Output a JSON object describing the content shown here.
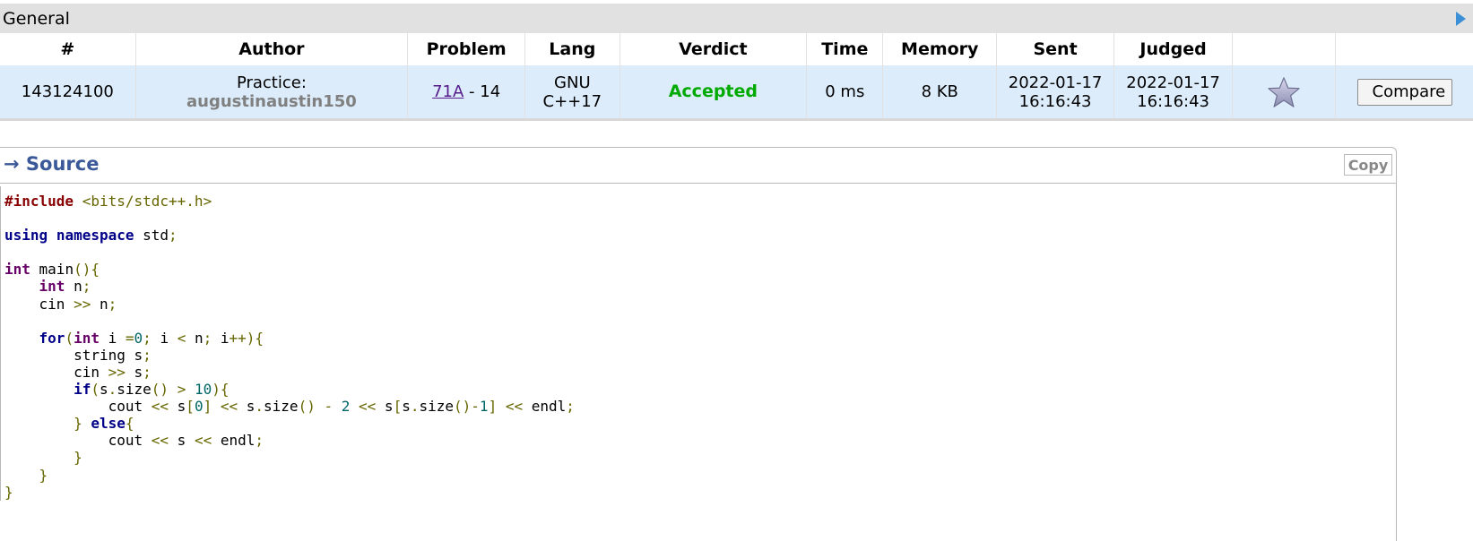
{
  "general": {
    "title": "General",
    "columns": [
      "#",
      "Author",
      "Problem",
      "Lang",
      "Verdict",
      "Time",
      "Memory",
      "Sent",
      "Judged",
      "",
      ""
    ],
    "row": {
      "id": "143124100",
      "author_prefix": "Practice:",
      "author_handle": "augustinaustin150",
      "problem_link": "71A",
      "problem_suffix": " - 14",
      "lang_line1": "GNU",
      "lang_line2": "C++17",
      "verdict": "Accepted",
      "time": "0 ms",
      "memory": "8 KB",
      "sent_date": "2022-01-17",
      "sent_time": "16:16:43",
      "judged_date": "2022-01-17",
      "judged_time": "16:16:43",
      "compare_label": "Compare"
    },
    "colors": {
      "header_bg": "#e1e1e1",
      "row_bg": "#dcecfb",
      "accepted": "#00aa00",
      "link": "#551a8b"
    }
  },
  "source": {
    "title": "→ Source",
    "copy_label": "Copy",
    "code_lines": [
      [
        [
          "pp",
          "#include"
        ],
        [
          "pl",
          " "
        ],
        [
          "op",
          "<bits/stdc++.h>"
        ]
      ],
      [],
      [
        [
          "kw",
          "using"
        ],
        [
          "pl",
          " "
        ],
        [
          "kw",
          "namespace"
        ],
        [
          "pl",
          " std"
        ],
        [
          "op",
          ";"
        ]
      ],
      [],
      [
        [
          "ty",
          "int"
        ],
        [
          "pl",
          " main"
        ],
        [
          "op",
          "(){"
        ]
      ],
      [
        [
          "pl",
          "    "
        ],
        [
          "ty",
          "int"
        ],
        [
          "pl",
          " n"
        ],
        [
          "op",
          ";"
        ]
      ],
      [
        [
          "pl",
          "    cin "
        ],
        [
          "op",
          ">>"
        ],
        [
          "pl",
          " n"
        ],
        [
          "op",
          ";"
        ]
      ],
      [],
      [
        [
          "pl",
          "    "
        ],
        [
          "kw",
          "for"
        ],
        [
          "op",
          "("
        ],
        [
          "ty",
          "int"
        ],
        [
          "pl",
          " i "
        ],
        [
          "op",
          "="
        ],
        [
          "num",
          "0"
        ],
        [
          "op",
          ";"
        ],
        [
          "pl",
          " i "
        ],
        [
          "op",
          "<"
        ],
        [
          "pl",
          " n"
        ],
        [
          "op",
          ";"
        ],
        [
          "pl",
          " i"
        ],
        [
          "op",
          "++){"
        ]
      ],
      [
        [
          "pl",
          "        string s"
        ],
        [
          "op",
          ";"
        ]
      ],
      [
        [
          "pl",
          "        cin "
        ],
        [
          "op",
          ">>"
        ],
        [
          "pl",
          " s"
        ],
        [
          "op",
          ";"
        ]
      ],
      [
        [
          "pl",
          "        "
        ],
        [
          "kw",
          "if"
        ],
        [
          "op",
          "("
        ],
        [
          "pl",
          "s"
        ],
        [
          "op",
          "."
        ],
        [
          "pl",
          "size"
        ],
        [
          "op",
          "()"
        ],
        [
          "pl",
          " "
        ],
        [
          "op",
          ">"
        ],
        [
          "pl",
          " "
        ],
        [
          "num",
          "10"
        ],
        [
          "op",
          "){"
        ]
      ],
      [
        [
          "pl",
          "            cout "
        ],
        [
          "op",
          "<<"
        ],
        [
          "pl",
          " s"
        ],
        [
          "op",
          "["
        ],
        [
          "num",
          "0"
        ],
        [
          "op",
          "]"
        ],
        [
          "pl",
          " "
        ],
        [
          "op",
          "<<"
        ],
        [
          "pl",
          " s"
        ],
        [
          "op",
          "."
        ],
        [
          "pl",
          "size"
        ],
        [
          "op",
          "()"
        ],
        [
          "pl",
          " "
        ],
        [
          "op",
          "-"
        ],
        [
          "pl",
          " "
        ],
        [
          "num",
          "2"
        ],
        [
          "pl",
          " "
        ],
        [
          "op",
          "<<"
        ],
        [
          "pl",
          " s"
        ],
        [
          "op",
          "["
        ],
        [
          "pl",
          "s"
        ],
        [
          "op",
          "."
        ],
        [
          "pl",
          "size"
        ],
        [
          "op",
          "()-"
        ],
        [
          "num",
          "1"
        ],
        [
          "op",
          "]"
        ],
        [
          "pl",
          " "
        ],
        [
          "op",
          "<<"
        ],
        [
          "pl",
          " endl"
        ],
        [
          "op",
          ";"
        ]
      ],
      [
        [
          "pl",
          "        "
        ],
        [
          "op",
          "}"
        ],
        [
          "pl",
          " "
        ],
        [
          "kw",
          "else"
        ],
        [
          "op",
          "{"
        ]
      ],
      [
        [
          "pl",
          "            cout "
        ],
        [
          "op",
          "<<"
        ],
        [
          "pl",
          " s "
        ],
        [
          "op",
          "<<"
        ],
        [
          "pl",
          " endl"
        ],
        [
          "op",
          ";"
        ]
      ],
      [
        [
          "pl",
          "        "
        ],
        [
          "op",
          "}"
        ]
      ],
      [
        [
          "pl",
          "    "
        ],
        [
          "op",
          "}"
        ]
      ],
      [
        [
          "op",
          "}"
        ]
      ]
    ]
  }
}
